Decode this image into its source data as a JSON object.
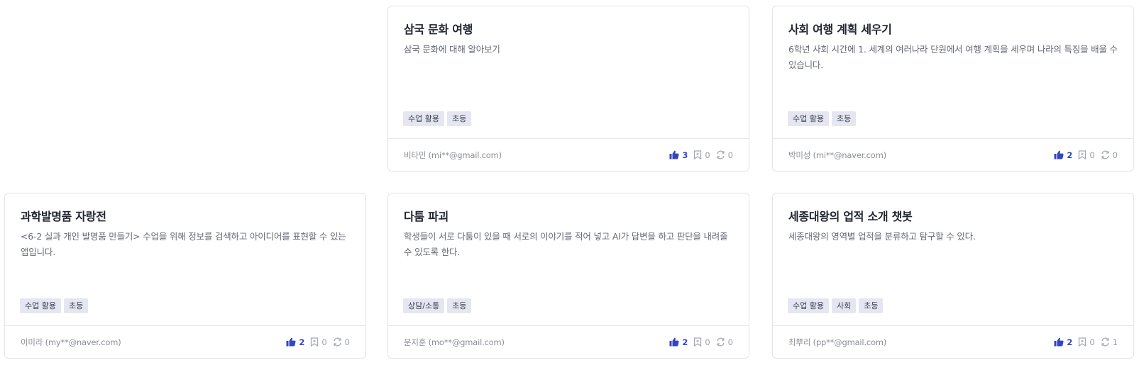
{
  "colors": {
    "like": "#3346c0",
    "muted_icon": "#a5a9b3",
    "tag_bg": "#e4e7f1"
  },
  "cards": [
    {
      "title": "삼국 문화 여행",
      "description": "삼국 문화에 대해 알아보기",
      "tags": [
        "수업 활용",
        "초등"
      ],
      "author": "비타민 (mi**@gmail.com)",
      "likes": "3",
      "bookmarks": "0",
      "remixes": "0"
    },
    {
      "title": "사회 여행 계획 세우기",
      "description": "6학년 사회 시간에 1. 세계의 여러나라 단원에서 여행 계획을 세우며 나라의 특징을 배울 수 있습니다.",
      "tags": [
        "수업 활용",
        "초등"
      ],
      "author": "박미성 (mi**@naver.com)",
      "likes": "2",
      "bookmarks": "0",
      "remixes": "0"
    },
    {
      "title": "과학발명품 자랑전",
      "description": "<6-2 실과 개인 발명품 만들기> 수업을 위해 정보를 검색하고 아이디어를 표현할 수 있는 앱입니다.",
      "tags": [
        "수업 활용",
        "초등"
      ],
      "author": "이미라 (my**@naver.com)",
      "likes": "2",
      "bookmarks": "0",
      "remixes": "0"
    },
    {
      "title": "다툼 파괴",
      "description": "학생들이 서로 다툼이 있을 때 서로의 이야기를 적어 넣고 AI가 답변을 하고 판단을 내려줄 수 있도록 한다.",
      "tags": [
        "상담/소통",
        "초등"
      ],
      "author": "문지훈 (mo**@gmail.com)",
      "likes": "2",
      "bookmarks": "0",
      "remixes": "0"
    },
    {
      "title": "세종대왕의 업적 소개 챗봇",
      "description": "세종대왕의 영역별 업적을 분류하고 탐구할 수 있다.",
      "tags": [
        "수업 활용",
        "사회",
        "초등"
      ],
      "author": "최뿌리 (pp**@gmail.com)",
      "likes": "2",
      "bookmarks": "0",
      "remixes": "1"
    }
  ]
}
